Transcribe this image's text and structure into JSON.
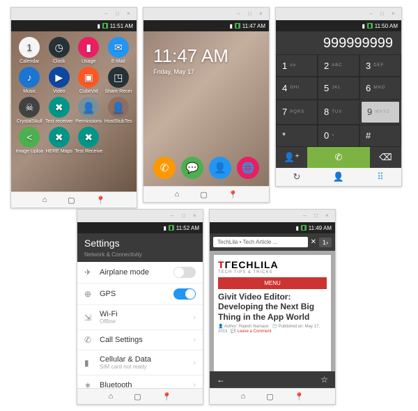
{
  "s1": {
    "time": "11:51 AM",
    "apps": [
      {
        "label": "Calendar",
        "bg": "#f5f5f5",
        "glyph": "1",
        "fg": "#555"
      },
      {
        "label": "Clock",
        "bg": "#263238",
        "glyph": "◷"
      },
      {
        "label": "Usage",
        "bg": "#e91e63",
        "glyph": "▮"
      },
      {
        "label": "E-Mail",
        "bg": "#2196f3",
        "glyph": "✉"
      },
      {
        "label": "Music",
        "bg": "#1976d2",
        "glyph": "♪"
      },
      {
        "label": "Video",
        "bg": "#0d47a1",
        "glyph": "▶"
      },
      {
        "label": "CubeVid",
        "bg": "#ff5722",
        "glyph": "▣"
      },
      {
        "label": "Share Recei",
        "bg": "#263238",
        "glyph": "◳"
      },
      {
        "label": "CrystalSkull",
        "bg": "#424242",
        "glyph": "☠"
      },
      {
        "label": "Test receiver",
        "bg": "#009688",
        "glyph": "✖"
      },
      {
        "label": "Permissions",
        "bg": "#78909c",
        "glyph": "👤"
      },
      {
        "label": "HostStubTes",
        "bg": "#8d6e63",
        "glyph": "👤"
      },
      {
        "label": "Image Uploa",
        "bg": "#4caf50",
        "glyph": "<"
      },
      {
        "label": "HERE Maps",
        "bg": "#009688",
        "glyph": "✖"
      },
      {
        "label": "Test Receive",
        "bg": "#009688",
        "glyph": "✖"
      }
    ]
  },
  "s2": {
    "time": "11:47 AM",
    "clock": "11:47 AM",
    "date": "Friday, May 17",
    "dock": [
      {
        "bg": "#ff9800",
        "glyph": "✆"
      },
      {
        "bg": "#4caf50",
        "glyph": "💬"
      },
      {
        "bg": "#2196f3",
        "glyph": "👤"
      },
      {
        "bg": "#e91e63",
        "glyph": "🌐"
      }
    ]
  },
  "s3": {
    "time": "11:50 AM",
    "number": "999999999",
    "keys": [
      {
        "n": "1",
        "s": "ᴏᴏ"
      },
      {
        "n": "2",
        "s": "ABC"
      },
      {
        "n": "3",
        "s": "DEF"
      },
      {
        "n": "4",
        "s": "GHI"
      },
      {
        "n": "5",
        "s": "JKL"
      },
      {
        "n": "6",
        "s": "MNO"
      },
      {
        "n": "7",
        "s": "PQRS"
      },
      {
        "n": "8",
        "s": "TUV"
      },
      {
        "n": "9",
        "s": "WXYZ"
      },
      {
        "n": "*",
        "s": ""
      },
      {
        "n": "0",
        "s": "+"
      },
      {
        "n": "#",
        "s": ""
      }
    ]
  },
  "s4": {
    "time": "11:52 AM",
    "title": "Settings",
    "subtitle": "Network & Connectivity",
    "items": [
      {
        "icon": "✈",
        "label": "Airplane mode",
        "toggle": "off"
      },
      {
        "icon": "⊕",
        "label": "GPS",
        "toggle": "on"
      },
      {
        "icon": "⇲",
        "label": "Wi-Fi",
        "sub": "Offline"
      },
      {
        "icon": "✆",
        "label": "Call Settings"
      },
      {
        "icon": "▮",
        "label": "Cellular & Data",
        "sub": "SIM card not ready"
      },
      {
        "icon": "∗",
        "label": "Bluetooth"
      }
    ]
  },
  "s5": {
    "time": "11:49 AM",
    "url": "TechLila • Tech Article ...",
    "tabcount": "1",
    "logo1": "T",
    "logo2": "ΓECHLILA",
    "tagline": "TECH TIPS & TRICKS",
    "menu": "MENU",
    "article": "Givit Video Editor: Developing the Next Big Thing in the App World",
    "author": "Author: Rajesh Namase",
    "pub": "Published on: May 17, 2013",
    "comments": "Leave a Comment"
  }
}
